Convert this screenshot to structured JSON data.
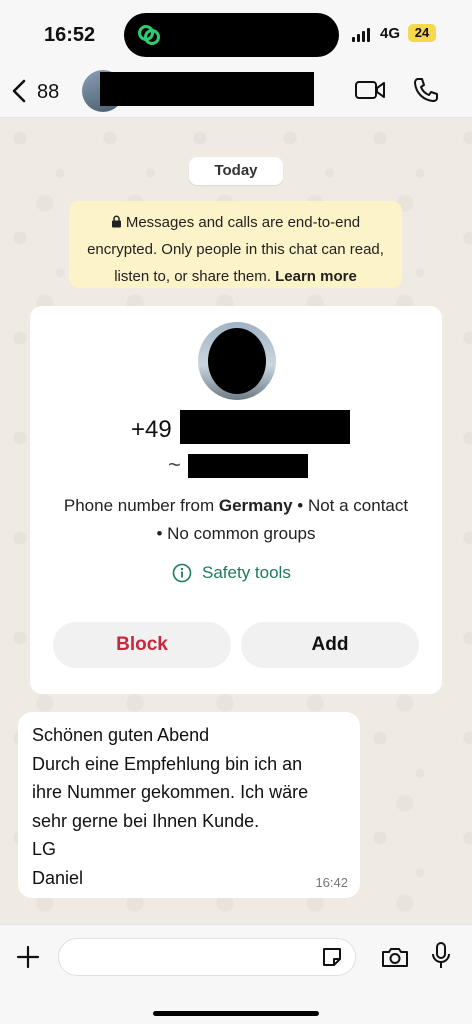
{
  "status_bar": {
    "time": "16:52",
    "network": "4G",
    "battery": "24",
    "battery_color": "#f5d84b"
  },
  "header": {
    "back_count": "88",
    "icons": [
      "chevron-left-icon",
      "video-call-icon",
      "phone-call-icon"
    ]
  },
  "chat": {
    "date_label": "Today",
    "encryption_notice": {
      "text": "Messages and calls are end-to-end encrypted. Only people in this chat can read, listen to, or share them.",
      "link": "Learn more"
    },
    "contact_card": {
      "phone_prefix": "+49",
      "tilde": "~",
      "info_prefix": "Phone number from ",
      "country": "Germany",
      "info_suffix": " • Not a contact • No common groups",
      "safety_tools": "Safety tools",
      "block_label": "Block",
      "add_label": "Add",
      "block_color": "#c8273c",
      "link_color": "#1f7a5a"
    },
    "message": {
      "lines": [
        "Schönen guten Abend",
        "Durch eine Empfehlung bin ich an",
        "ihre Nummer gekommen. Ich wäre",
        "sehr gerne bei Ihnen Kunde.",
        "LG",
        "Daniel"
      ],
      "time": "16:42"
    }
  },
  "input_bar": {
    "message_value": "",
    "icons": [
      "plus-icon",
      "sticker-icon",
      "camera-icon",
      "microphone-icon"
    ]
  }
}
